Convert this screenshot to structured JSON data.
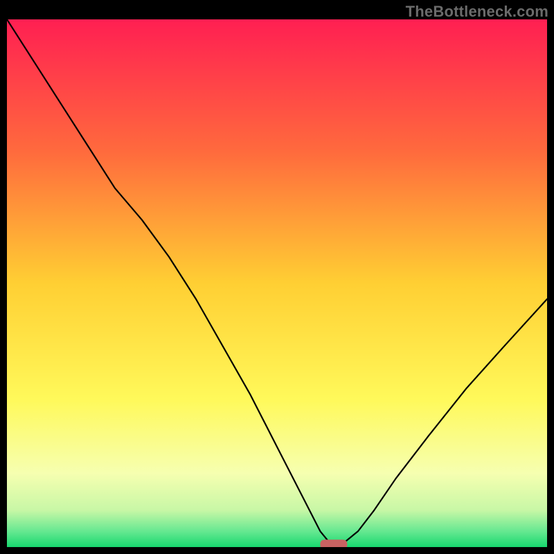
{
  "watermark": "TheBottleneck.com",
  "chart_data": {
    "type": "line",
    "title": "",
    "xlabel": "",
    "ylabel": "",
    "xlim": [
      0,
      100
    ],
    "ylim": [
      0,
      100
    ],
    "grid": false,
    "x": [
      0,
      5,
      10,
      15,
      20,
      25,
      30,
      35,
      40,
      45,
      50,
      55,
      58,
      60,
      62,
      65,
      68,
      72,
      78,
      85,
      92,
      100
    ],
    "values": [
      100,
      92,
      84,
      76,
      68,
      62,
      55,
      47,
      38,
      29,
      19,
      9,
      3,
      0.5,
      0.5,
      3,
      7,
      13,
      21,
      30,
      38,
      47
    ],
    "marker": {
      "x_range": [
        58,
        63
      ],
      "y": 0.5
    },
    "gradient_stops": [
      {
        "offset": 0.0,
        "color": "#ff1f52"
      },
      {
        "offset": 0.25,
        "color": "#ff6a3d"
      },
      {
        "offset": 0.5,
        "color": "#ffcf33"
      },
      {
        "offset": 0.72,
        "color": "#fff95a"
      },
      {
        "offset": 0.86,
        "color": "#f6ffb0"
      },
      {
        "offset": 0.93,
        "color": "#c8f7a6"
      },
      {
        "offset": 0.97,
        "color": "#66e891"
      },
      {
        "offset": 1.0,
        "color": "#17d86e"
      }
    ]
  }
}
